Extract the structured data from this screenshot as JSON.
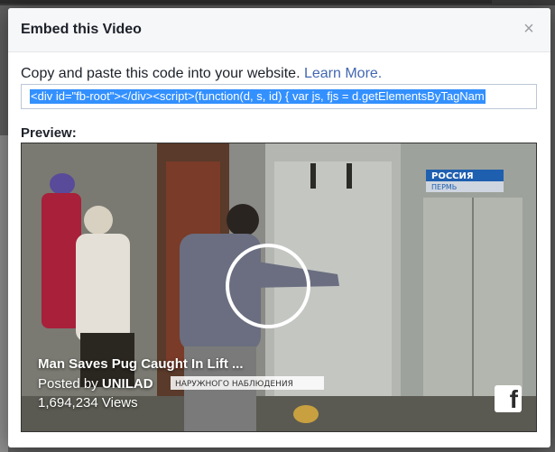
{
  "dialog": {
    "title": "Embed this Video",
    "close_label": "×",
    "instruction_text": "Copy and paste this code into your website.",
    "learn_more_link": "Learn More.",
    "embed_code": "<div id=\"fb-root\"></div><script>(function(d, s, id) {  var js, fjs = d.getElementsByTagNam",
    "preview_label": "Preview:"
  },
  "video": {
    "title": "Man Saves Pug Caught In Lift ...",
    "posted_prefix": "Posted by ",
    "posted_by": "UNILAD",
    "views": "1,694,234 Views",
    "channel_logo_text": "РОССИЯ",
    "channel_region_text": "ПЕРМЬ",
    "overlay_text": "НАРУЖНОГО НАБЛЮДЕНИЯ"
  },
  "colors": {
    "link": "#4267b2",
    "selection": "#3390ff"
  }
}
